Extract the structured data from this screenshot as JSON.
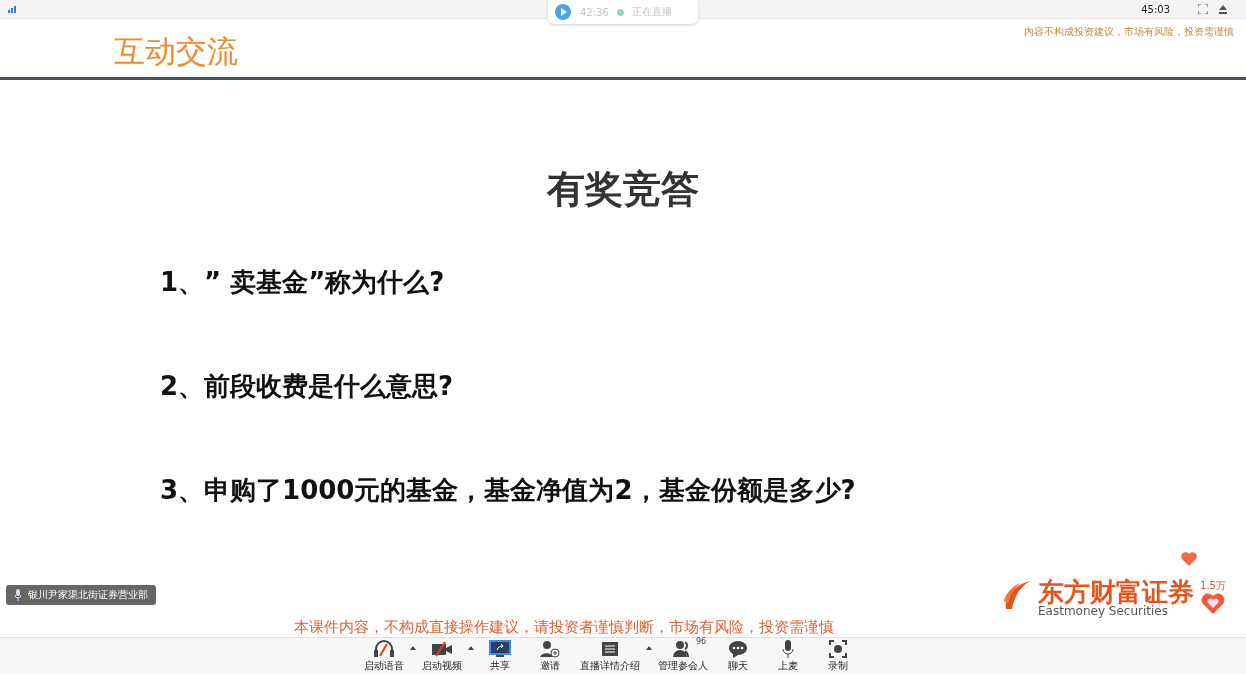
{
  "top_bar": {
    "live_timer": "42:36",
    "live_status": "正在直播",
    "clock": "45:03"
  },
  "slide": {
    "header": "互动交流",
    "disclaimer": "内容不构成投资建议，市场有风险，投资需谨慎",
    "title": "有奖竞答",
    "questions": [
      "1、” 卖基金”称为什么?",
      "2、前段收费是什么意思?",
      "3、申购了1000元的基金，基金净值为2，基金份额是多少?"
    ],
    "footer_note": "本课件内容，不构成直接操作建议，请投资者谨慎判断，市场有风险，投资需谨慎",
    "logo": {
      "name": "东方财富证券",
      "english": "Eastmoney Securities"
    }
  },
  "speaker": "银川尹家渠北街证券营业部",
  "likes": "1.5万",
  "toolbar": [
    {
      "kind": "audio",
      "label": "启动语音",
      "dropdown": true
    },
    {
      "kind": "video",
      "label": "启动视频",
      "dropdown": true
    },
    {
      "kind": "share",
      "label": "共享",
      "dropdown": false
    },
    {
      "kind": "invite",
      "label": "邀请",
      "dropdown": false
    },
    {
      "kind": "info",
      "label": "直播详情介绍",
      "dropdown": true
    },
    {
      "kind": "people",
      "label": "管理参会人",
      "count": "96",
      "dropdown": false
    },
    {
      "kind": "chat",
      "label": "聊天",
      "dropdown": false
    },
    {
      "kind": "mic",
      "label": "上麦",
      "dropdown": false
    },
    {
      "kind": "record",
      "label": "录制",
      "dropdown": false
    }
  ]
}
